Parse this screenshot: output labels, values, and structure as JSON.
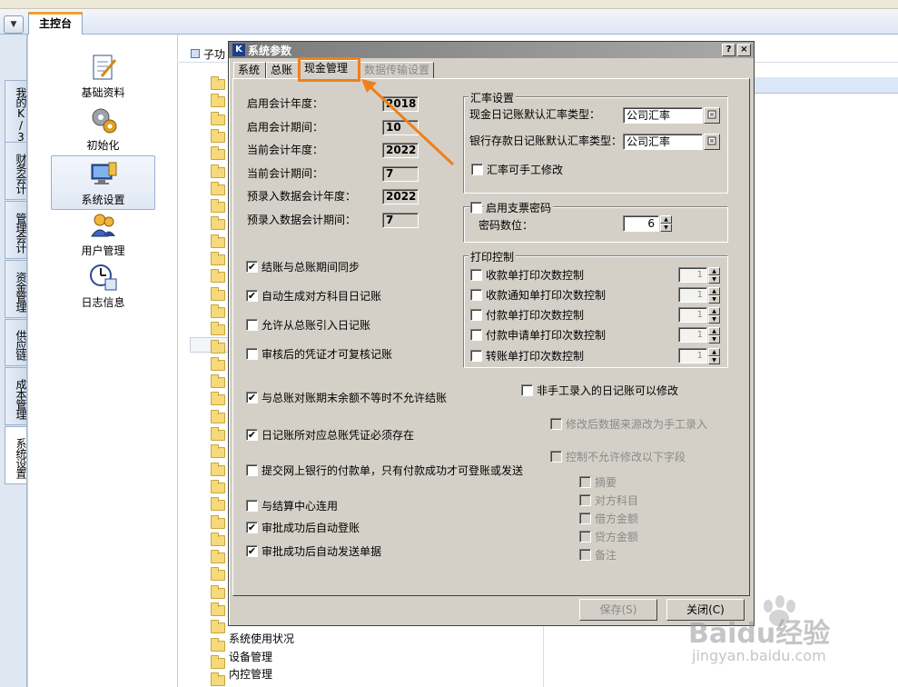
{
  "top": {
    "main_tab": "主控台",
    "dropdown": "▼"
  },
  "left_tabs": [
    {
      "label": "我的K/3"
    },
    {
      "label": "财务会计"
    },
    {
      "label": "管理会计"
    },
    {
      "label": "资金管理"
    },
    {
      "label": "供应链"
    },
    {
      "label": "成本管理"
    },
    {
      "label": "系统设置"
    }
  ],
  "modules": [
    {
      "label": "基础资料",
      "icon": "document-pen-icon"
    },
    {
      "label": "初始化",
      "icon": "gears-icon"
    },
    {
      "label": "系统设置",
      "icon": "monitor-settings-icon"
    },
    {
      "label": "用户管理",
      "icon": "users-icon"
    },
    {
      "label": "日志信息",
      "icon": "clock-log-icon"
    }
  ],
  "tree": {
    "header": "子功",
    "bottom_items": [
      "系统使用状况",
      "设备管理",
      "内控管理"
    ]
  },
  "dialog": {
    "title": "系统参数",
    "title_icon": "K",
    "help_btn": "?",
    "close_btn": "×",
    "tabs": [
      {
        "label": "系统",
        "state": "normal"
      },
      {
        "label": "总账",
        "state": "normal"
      },
      {
        "label": "现金管理",
        "state": "active"
      },
      {
        "label": "数据传输设置",
        "state": "disabled"
      }
    ],
    "fields": [
      {
        "label": "启用会计年度：",
        "value": "2018"
      },
      {
        "label": "启用会计期间：",
        "value": "10"
      },
      {
        "label": "当前会计年度：",
        "value": "2022"
      },
      {
        "label": "当前会计期间：",
        "value": "7"
      },
      {
        "label": "预录入数据会计年度：",
        "value": "2022"
      },
      {
        "label": "预录入数据会计期间：",
        "value": "7"
      }
    ],
    "left_checks": [
      {
        "label": "结账与总账期间同步",
        "checked": true
      },
      {
        "label": "自动生成对方科目日记账",
        "checked": true
      },
      {
        "label": "允许从总账引入日记账",
        "checked": false
      },
      {
        "label": "审核后的凭证才可复核记账",
        "checked": false
      },
      {
        "label": "与总账对账期末余额不等时不允许结账",
        "checked": true
      },
      {
        "label": "日记账所对应总账凭证必须存在",
        "checked": true
      },
      {
        "label": "提交网上银行的付款单，只有付款成功才可登账或发送",
        "checked": false
      },
      {
        "label": "与结算中心连用",
        "checked": false
      },
      {
        "label": "审批成功后自动登账",
        "checked": true
      },
      {
        "label": "审批成功后自动发送单据",
        "checked": true
      }
    ],
    "exchange": {
      "title": "汇率设置",
      "cash_label": "现金日记账默认汇率类型：",
      "cash_value": "公司汇率",
      "bank_label": "银行存款日记账默认汇率类型：",
      "bank_value": "公司汇率",
      "manual_label": "汇率可手工修改",
      "manual_checked": false
    },
    "cheque": {
      "enable_label": "启用支票密码",
      "enable_checked": false,
      "digits_label": "密码数位：",
      "digits_value": "6"
    },
    "print": {
      "title": "打印控制",
      "items": [
        {
          "label": "收款单打印次数控制",
          "value": "1"
        },
        {
          "label": "收款通知单打印次数控制",
          "value": "1"
        },
        {
          "label": "付款单打印次数控制",
          "value": "1"
        },
        {
          "label": "付款申请单打印次数控制",
          "value": "1"
        },
        {
          "label": "转账单打印次数控制",
          "value": "1"
        }
      ]
    },
    "nonmanual": {
      "label": "非手工录入的日记账可以修改",
      "sub1": "修改后数据来源改为手工录入",
      "sub2": "控制不允许修改以下字段",
      "fields": [
        "摘要",
        "对方科目",
        "借方金额",
        "贷方金额",
        "备注"
      ]
    },
    "buttons": {
      "save": "保存(S)",
      "close": "关闭(C)"
    }
  },
  "watermark": {
    "brand": "Baidu经验",
    "url": "jingyan.baidu.com"
  },
  "colors": {
    "highlight": "#f07f1a",
    "dialog_bg": "#d4d0c8",
    "titlebar": "#8f8f8f"
  }
}
